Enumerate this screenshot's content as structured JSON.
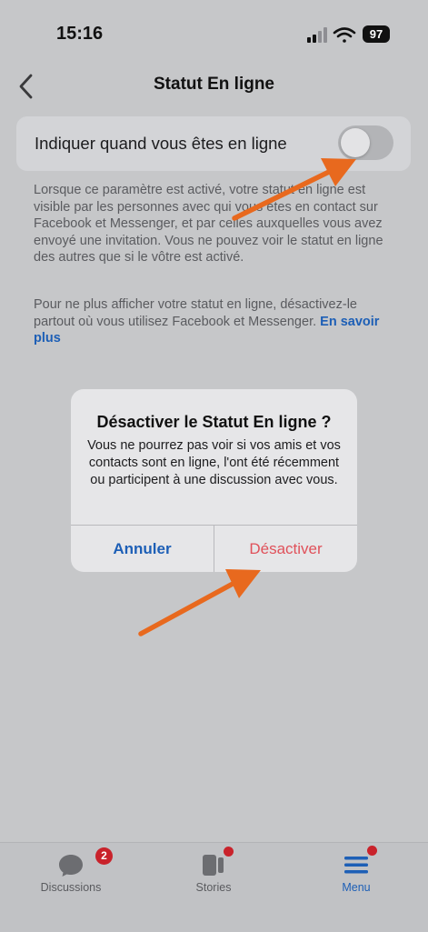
{
  "status_bar": {
    "time": "15:16",
    "battery": "97"
  },
  "header": {
    "title": "Statut En ligne"
  },
  "setting": {
    "label": "Indiquer quand vous êtes en ligne",
    "enabled": false
  },
  "description": {
    "paragraph1": "Lorsque ce paramètre est activé, votre statut en ligne est visible par les personnes avec qui vous êtes en contact sur Facebook et Messenger, et par celles auxquelles vous avez envoyé une invitation. Vous ne pouvez voir le statut en ligne des autres que si le vôtre est activé.",
    "paragraph2": "Pour ne plus afficher votre statut en ligne, désactivez-le partout où vous utilisez Facebook et Messenger.",
    "link": "En savoir plus"
  },
  "dialog": {
    "title": "Désactiver le Statut En ligne ?",
    "message": "Vous ne pourrez pas voir si vos amis et vos contacts sont en ligne, l'ont été récemment ou participent à une discussion avec vous.",
    "cancel": "Annuler",
    "confirm": "Désactiver"
  },
  "tab_bar": {
    "tabs": [
      {
        "label": "Discussions",
        "icon": "chat-bubble-icon",
        "badge": "2"
      },
      {
        "label": "Stories",
        "icon": "stories-icon"
      },
      {
        "label": "Menu",
        "icon": "menu-icon"
      }
    ]
  },
  "colors": {
    "accent": "#1d5fb6",
    "destructive": "#e0515a",
    "annotation_arrow": "#e8691e",
    "badge": "#c9222b"
  }
}
